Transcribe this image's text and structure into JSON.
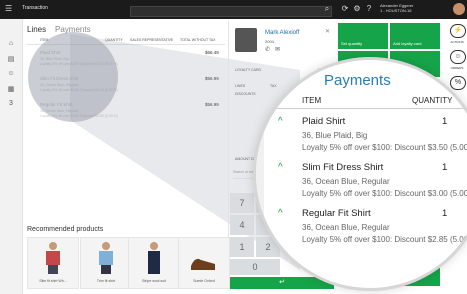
{
  "topbar": {
    "title": "Transaction",
    "user_name": "Alexander Eggerer",
    "user_id": "1 - HOUSTON-16"
  },
  "tabs": {
    "lines": "Lines",
    "payments": "Payments"
  },
  "lines_table": {
    "headers": [
      "ITEM",
      "QUANTITY",
      "SALES REPRESENTATIVE",
      "TOTAL WITHOUT TAX"
    ],
    "rows": [
      {
        "name": "Plaid Shirt",
        "sub1": "36, Blue Plaid, Big",
        "sub2": "Loyalty 5% off over $100: Discount $3.50 (5.00 %)",
        "price": "$66.49"
      },
      {
        "name": "Slim Fit Dress Shirt",
        "sub1": "36, Ocean Blue, Regular",
        "sub2": "Loyalty 5% off over $100: Discount $3.00 (5.00 %)",
        "price": "$56.99"
      },
      {
        "name": "Regular Fit Shirt",
        "sub1": "36, Ocean Blue, Regular",
        "sub2": "Loyalty 5% off over $100: Discount $2.85 (5.00 %)",
        "price": "$56.99"
      }
    ]
  },
  "customer": {
    "name": "Mark Alexioff",
    "account": "2004",
    "loyalty_card_label": "LOYALTY CARD",
    "loyalty_card_value": "9234",
    "lines_label": "LINES",
    "discounts_label": "DISCOUNTS",
    "tax_label": "TAX",
    "amount_due_label": "AMOUNT DUE",
    "search_placeholder": "Search or enter quantity"
  },
  "tiles": {
    "set_quantity": "Set quantity",
    "add_loyalty_card": "Add loyalty card",
    "change_unit": "Change unit",
    "line_comment": "Line comment",
    "pay_cash": "Pay cash",
    "pay_card": "Pay card"
  },
  "right_icons": [
    "ACTIONS",
    "ORDERS",
    "DISCOUNTS"
  ],
  "keypad": {
    "keys": [
      "7",
      "8",
      "4",
      "5",
      "1",
      "2",
      "0"
    ],
    "enter": "↵"
  },
  "recommended": {
    "title": "Recommended products",
    "products": [
      "Slim fit shirt Wh...",
      "Trim fit shirt",
      "Stripe wool suit",
      "Suede Oxford"
    ]
  },
  "magnifier": {
    "title": "Payments",
    "col_item": "ITEM",
    "col_qty": "QUANTITY",
    "items": [
      {
        "name": "Plaid Shirt",
        "qty": "1",
        "sub1": "36, Blue Plaid, Big",
        "sub2": "Loyalty 5% off over $100: Discount $3.50 (5.00 %)"
      },
      {
        "name": "Slim Fit Dress Shirt",
        "qty": "1",
        "sub1": "36, Ocean Blue, Regular",
        "sub2": "Loyalty 5% off over $100: Discount $3.00 (5.00 %)"
      },
      {
        "name": "Regular Fit Shirt",
        "qty": "1",
        "sub1": "36, Ocean Blue, Regular",
        "sub2": "Loyalty 5% off over $100: Discount $2.85 (5.00 %)"
      }
    ]
  },
  "colors": {
    "accent_green": "#16a44a",
    "accent_blue": "#2b7bb9",
    "topbar": "#1b1b1b"
  }
}
